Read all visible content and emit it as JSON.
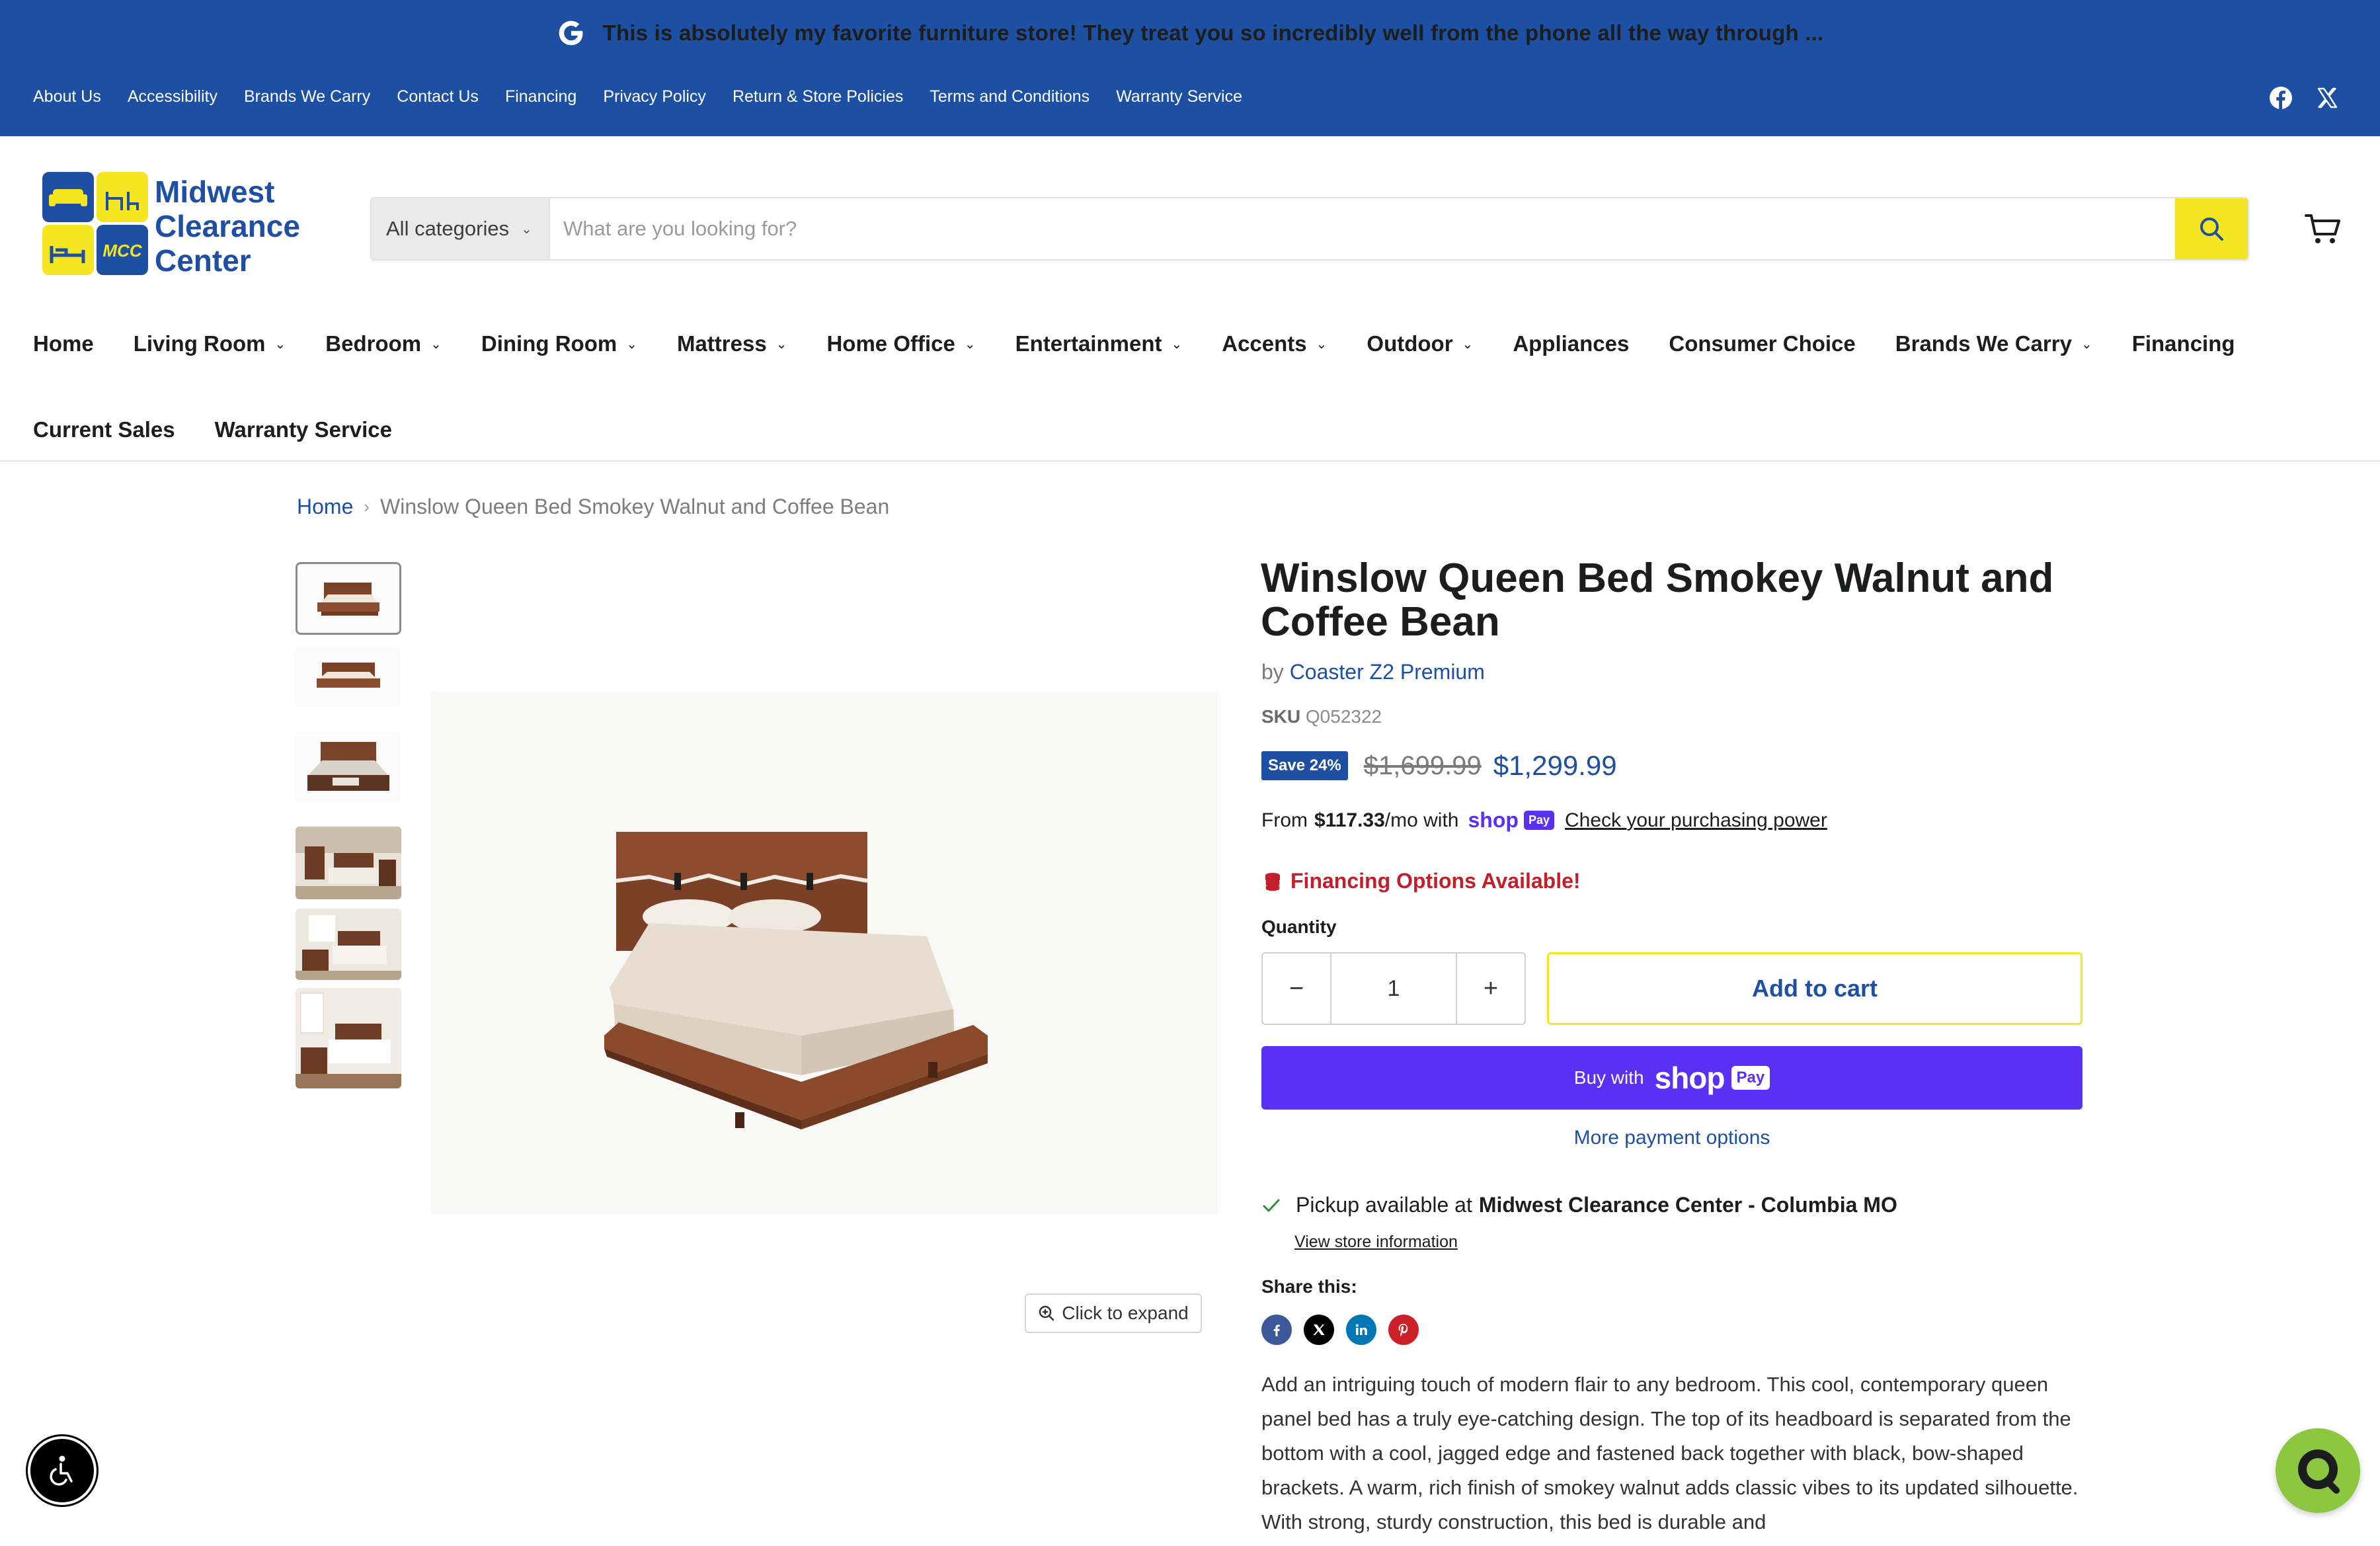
{
  "announcement": {
    "text": "This is absolutely my favorite furniture store! They treat you so incredibly well from the phone all the way through ..."
  },
  "utility_nav": [
    "About Us",
    "Accessibility",
    "Brands We Carry",
    "Contact Us",
    "Financing",
    "Privacy Policy",
    "Return & Store Policies",
    "Terms and Conditions",
    "Warranty Service"
  ],
  "social": [
    "facebook-icon",
    "x-icon"
  ],
  "logo": {
    "line1": "Midwest",
    "line2": "Clearance",
    "line3": "Center",
    "badge": "MCC"
  },
  "search": {
    "category": "All categories",
    "placeholder": "What are you looking for?"
  },
  "main_nav": [
    {
      "label": "Home",
      "dropdown": false
    },
    {
      "label": "Living Room",
      "dropdown": true
    },
    {
      "label": "Bedroom",
      "dropdown": true
    },
    {
      "label": "Dining Room",
      "dropdown": true
    },
    {
      "label": "Mattress",
      "dropdown": true
    },
    {
      "label": "Home Office",
      "dropdown": true
    },
    {
      "label": "Entertainment",
      "dropdown": true
    },
    {
      "label": "Accents",
      "dropdown": true
    },
    {
      "label": "Outdoor",
      "dropdown": true
    },
    {
      "label": "Appliances",
      "dropdown": false
    },
    {
      "label": "Consumer Choice",
      "dropdown": false
    },
    {
      "label": "Brands We Carry",
      "dropdown": true
    },
    {
      "label": "Financing",
      "dropdown": false
    },
    {
      "label": "Current Sales",
      "dropdown": false
    },
    {
      "label": "Warranty Service",
      "dropdown": false
    }
  ],
  "breadcrumb": {
    "home": "Home",
    "separator": "›",
    "current": "Winslow Queen Bed Smokey Walnut and Coffee Bean"
  },
  "gallery": {
    "expand_label": "Click to expand",
    "thumb_count": 6
  },
  "product": {
    "title": "Winslow Queen Bed Smokey Walnut and Coffee Bean",
    "by": "by",
    "vendor": "Coaster Z2 Premium",
    "sku_label": "SKU",
    "sku": "Q052322",
    "save_badge": "Save 24%",
    "compare_price": "$1,699.99",
    "price": "$1,299.99",
    "installments": {
      "from": "From",
      "amount": "$117.33",
      "suffix": "/mo with",
      "wordmark": "shop",
      "pay": "Pay",
      "link": "Check your purchasing power"
    },
    "financing": "Financing Options Available!",
    "quantity_label": "Quantity",
    "quantity": "1",
    "minus": "−",
    "plus": "+",
    "add_to_cart": "Add to cart",
    "buy_with": "Buy with",
    "buy_wordmark": "shop",
    "buy_pay": "Pay",
    "more_payment": "More payment options",
    "pickup_prefix": "Pickup available at",
    "pickup_store": "Midwest Clearance Center - Columbia MO",
    "store_info": "View store information",
    "share_label": "Share this:",
    "share": [
      "facebook",
      "x",
      "linkedin",
      "pinterest"
    ],
    "description": "Add an intriguing touch of modern flair to any bedroom. This cool, contemporary queen panel bed has a truly eye-catching design. The top of its headboard is separated from the bottom with a cool, jagged edge and fastened back together with black, bow-shaped brackets. A warm, rich finish of smokey walnut adds classic vibes to its updated silhouette. With strong, sturdy construction, this bed is durable and"
  },
  "colors": {
    "brand_blue": "#1d4fa3",
    "accent_yellow": "#f4e620",
    "shop_purple": "#5a31f4",
    "financing_red": "#c21f2b",
    "chat_green": "#8dc63f"
  }
}
